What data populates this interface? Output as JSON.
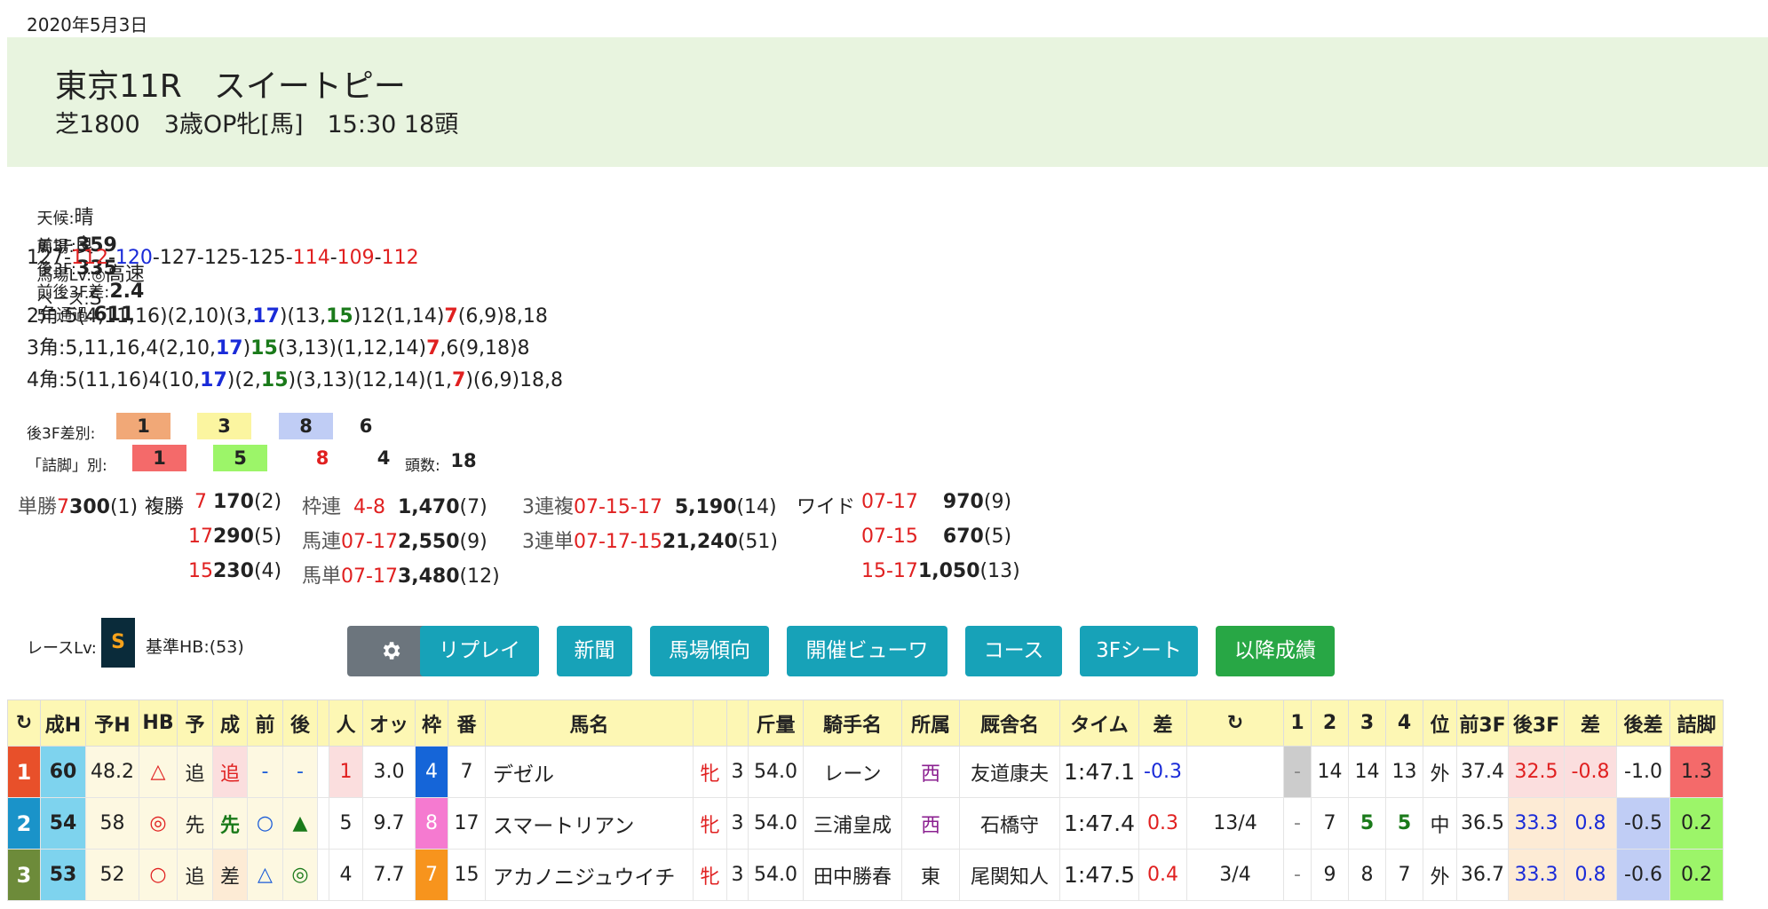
{
  "date": "2020年5月3日",
  "race": {
    "title": "東京11R　スイートピー",
    "subtitle": "芝1800　3歳OP牝[馬]　15:30 18頭"
  },
  "conditions": {
    "weather_label": "天候:",
    "weather": "晴",
    "track_label": "馬場:",
    "track": "良",
    "tracklv_label": "馬場Lv:◎",
    "tracklv": "高速",
    "pace_label": "ペース:",
    "pace": "S"
  },
  "threef": {
    "first_label": "前3F:",
    "first": "359",
    "last_label": "後3F:",
    "last": "335",
    "diff_label": "前後3F差:",
    "diff": "2.4",
    "pass_label": "5F通過:",
    "pass": "611"
  },
  "laps": [
    {
      "v": "127",
      "c": ""
    },
    {
      "v": "112",
      "c": "red"
    },
    {
      "v": "120",
      "c": "blue"
    },
    {
      "v": "127",
      "c": ""
    },
    {
      "v": "125",
      "c": ""
    },
    {
      "v": "125",
      "c": ""
    },
    {
      "v": "114",
      "c": "red"
    },
    {
      "v": "109",
      "c": "red"
    },
    {
      "v": "112",
      "c": "red"
    }
  ],
  "corners": [
    {
      "label": "2角:",
      "parts": [
        {
          "t": "5(4,11,16)(2,10)(3,",
          "c": ""
        },
        {
          "t": "17",
          "c": "blue"
        },
        {
          "t": ")(13,",
          "c": ""
        },
        {
          "t": "15",
          "c": "green"
        },
        {
          "t": ")12(1,14)",
          "c": ""
        },
        {
          "t": "7",
          "c": "red"
        },
        {
          "t": "(6,9)8,18",
          "c": ""
        }
      ]
    },
    {
      "label": "3角:",
      "parts": [
        {
          "t": "5,11,16,4(2,10,",
          "c": ""
        },
        {
          "t": "17",
          "c": "blue"
        },
        {
          "t": ")",
          "c": ""
        },
        {
          "t": "15",
          "c": "green"
        },
        {
          "t": "(3,13)(1,12,14)",
          "c": ""
        },
        {
          "t": "7",
          "c": "red"
        },
        {
          "t": ",6(9,18)8",
          "c": ""
        }
      ]
    },
    {
      "label": "4角:",
      "parts": [
        {
          "t": "5(11,16)4(10,",
          "c": ""
        },
        {
          "t": "17",
          "c": "blue"
        },
        {
          "t": ")(2,",
          "c": ""
        },
        {
          "t": "15",
          "c": "green"
        },
        {
          "t": ")(3,13)(12,14)(1,",
          "c": ""
        },
        {
          "t": "7",
          "c": "red"
        },
        {
          "t": ")(6,9)18,8",
          "c": ""
        }
      ]
    }
  ],
  "last3f_rank": {
    "label": "後3F差別:",
    "chips": [
      {
        "v": "1",
        "bg": "#f1a877",
        "fg": "#222"
      },
      {
        "v": "3",
        "bg": "#fbf5a0",
        "fg": "#222"
      },
      {
        "v": "8",
        "bg": "#c0cdf5",
        "fg": "#222"
      },
      {
        "v": "6",
        "bg": "transparent",
        "fg": "#222"
      }
    ]
  },
  "tsume_rank": {
    "label": "「詰脚」別:",
    "chips": [
      {
        "v": "1",
        "bg": "#f46a6a",
        "fg": "#222"
      },
      {
        "v": "5",
        "bg": "#9cf569",
        "fg": "#222"
      },
      {
        "v": "8",
        "bg": "transparent",
        "fg": "#e02020"
      },
      {
        "v": "4",
        "bg": "transparent",
        "fg": "#222"
      }
    ],
    "count_label": "頭数:",
    "count": "18"
  },
  "payouts": {
    "tansho": {
      "label": "単勝",
      "num": "7",
      "val": "300",
      "pop": "(1)"
    },
    "fukusho_label": "複勝",
    "fukusho": [
      {
        "num": "7",
        "val": "170",
        "pop": "(2)"
      },
      {
        "num": "17",
        "val": "290",
        "pop": "(5)"
      },
      {
        "num": "15",
        "val": "230",
        "pop": "(4)"
      }
    ],
    "wakuren": {
      "label": "枠連",
      "num": "4-8",
      "val": "1,470",
      "pop": "(7)"
    },
    "umaren": {
      "label": "馬連",
      "num": "07-17",
      "val": "2,550",
      "pop": "(9)"
    },
    "umatan": {
      "label": "馬単",
      "num": "07-17",
      "val": "3,480",
      "pop": "(12)"
    },
    "sanrenpuku": {
      "label": "3連複",
      "num": "07-15-17",
      "val": "5,190",
      "pop": "(14)"
    },
    "sanrentan": {
      "label": "3連単",
      "num": "07-17-15",
      "val": "21,240",
      "pop": "(51)"
    },
    "wide_label": "ワイド",
    "wide": [
      {
        "num": "07-17",
        "val": "970",
        "pop": "(9)"
      },
      {
        "num": "07-15",
        "val": "670",
        "pop": "(5)"
      },
      {
        "num": "15-17",
        "val": "1,050",
        "pop": "(13)"
      }
    ]
  },
  "race_level": {
    "label": "レースLv:",
    "value": "S",
    "hb_label": "基準HB:(53)"
  },
  "buttons": {
    "settings_icon": "gear-icon",
    "replay": "リプレイ",
    "newspaper": "新聞",
    "track_trend": "馬場傾向",
    "meeting_viewer": "開催ビューワ",
    "course": "コース",
    "sheet3f": "3Fシート",
    "later_results": "以降成績"
  },
  "table": {
    "headers": [
      "↻",
      "成H",
      "予H",
      "HB",
      "予",
      "成",
      "前",
      "後",
      "",
      "人",
      "オッ",
      "枠",
      "番",
      "馬名",
      "",
      "",
      "斤量",
      "騎手名",
      "所属",
      "厩舎名",
      "タイム",
      "差",
      "↻",
      "1",
      "2",
      "3",
      "4",
      "位",
      "前3F",
      "後3F",
      "差",
      "後差",
      "詰脚"
    ],
    "rows": [
      {
        "rank": "1",
        "rank_bg": "#e8502a",
        "seiH": "60",
        "yoH": "48.2",
        "hb": "△",
        "yo": "追",
        "sei": "追",
        "mae": "-",
        "ato": "-",
        "ninki": "1",
        "odds": "3.0",
        "waku": "4",
        "waku_bg": "#1565d8",
        "waku_fg": "#fff",
        "ban": "7",
        "name": "デゼル",
        "sex": "牝",
        "age": "3",
        "kinryo": "54.0",
        "jockey": "レーン",
        "shozoku": "西",
        "trainer": "友道康夫",
        "time": "1:47.1",
        "sa": "-0.3",
        "sa_c": "blue",
        "chakusa": "",
        "c1": "-",
        "c2": "14",
        "c3": "14",
        "c4": "13",
        "pos": "外",
        "f3": "37.4",
        "l3": "32.5",
        "l3sa": "-0.8",
        "atosa": "-1.0",
        "tsume": "1.3",
        "tsume_bg": "#f46a6a"
      },
      {
        "rank": "2",
        "rank_bg": "#1a93c9",
        "seiH": "54",
        "yoH": "58",
        "hb": "◎",
        "yo": "先",
        "sei": "先",
        "mae": "○",
        "ato": "▲",
        "ninki": "5",
        "odds": "9.7",
        "waku": "8",
        "waku_bg": "#f57ad0",
        "waku_fg": "#fff",
        "ban": "17",
        "name": "スマートリアン",
        "sex": "牝",
        "age": "3",
        "kinryo": "54.0",
        "jockey": "三浦皇成",
        "shozoku": "西",
        "trainer": "石橋守",
        "time": "1:47.4",
        "sa": "0.3",
        "sa_c": "red",
        "chakusa": "13/4",
        "c1": "-",
        "c2": "7",
        "c3": "5",
        "c4": "5",
        "pos": "中",
        "f3": "36.5",
        "l3": "33.3",
        "l3sa": "0.8",
        "atosa": "-0.5",
        "tsume": "0.2",
        "tsume_bg": "#9cf569"
      },
      {
        "rank": "3",
        "rank_bg": "#6d8b3a",
        "seiH": "53",
        "yoH": "52",
        "hb": "○",
        "yo": "追",
        "sei": "差",
        "mae": "△",
        "ato": "◎",
        "ninki": "4",
        "odds": "7.7",
        "waku": "7",
        "waku_bg": "#f7941d",
        "waku_fg": "#fff",
        "ban": "15",
        "name": "アカノニジュウイチ",
        "sex": "牝",
        "age": "3",
        "kinryo": "54.0",
        "jockey": "田中勝春",
        "shozoku": "東",
        "trainer": "尾関知人",
        "time": "1:47.5",
        "sa": "0.4",
        "sa_c": "red",
        "chakusa": "3/4",
        "c1": "-",
        "c2": "9",
        "c3": "8",
        "c4": "7",
        "pos": "外",
        "f3": "36.7",
        "l3": "33.3",
        "l3sa": "0.8",
        "atosa": "-0.6",
        "tsume": "0.2",
        "tsume_bg": "#9cf569"
      }
    ]
  }
}
